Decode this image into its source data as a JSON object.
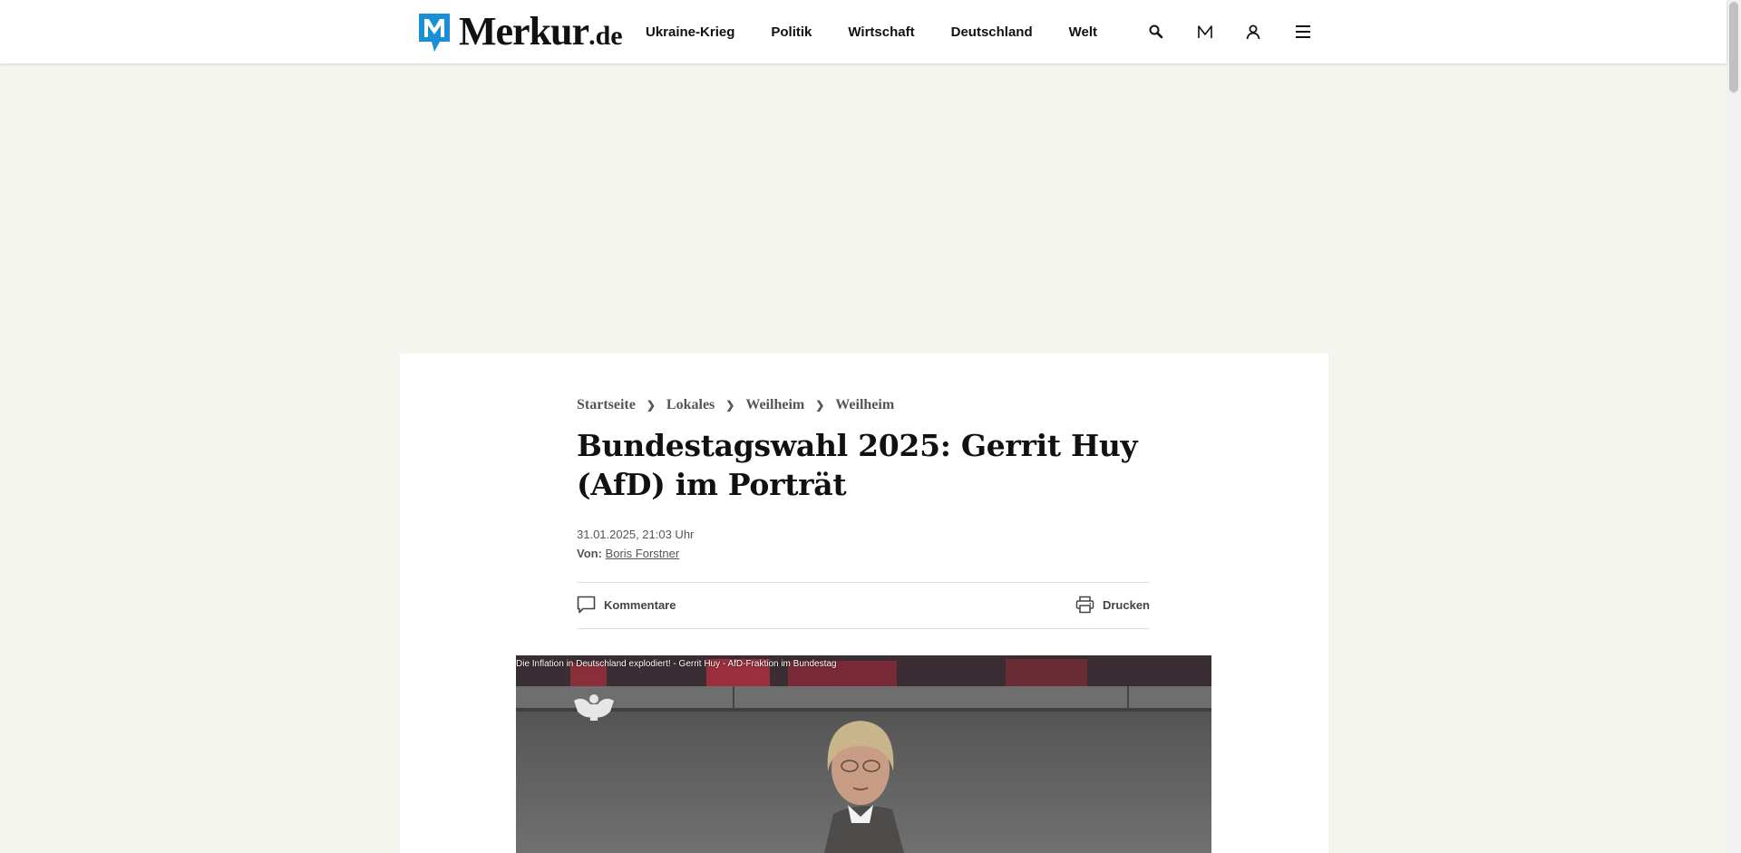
{
  "site": {
    "logo_text": "Merkur",
    "logo_tld": ".de",
    "brand_color": "#1a8fd6"
  },
  "nav": {
    "items": [
      {
        "label": "Ukraine-Krieg"
      },
      {
        "label": "Politik"
      },
      {
        "label": "Wirtschaft"
      },
      {
        "label": "Deutschland"
      },
      {
        "label": "Welt"
      }
    ],
    "icons": [
      "search-icon",
      "merkur-plus-icon",
      "user-icon",
      "menu-icon"
    ]
  },
  "breadcrumb": [
    {
      "label": "Startseite"
    },
    {
      "label": "Lokales"
    },
    {
      "label": "Weilheim"
    },
    {
      "label": "Weilheim"
    }
  ],
  "breadcrumb_separator": "❯",
  "article": {
    "headline": "Bundestagswahl 2025: Gerrit Huy (AfD) im Porträt",
    "date": "31.01.2025, 21:03 Uhr",
    "author_label": "Von:",
    "author_name": "Boris Forstner"
  },
  "toolbar": {
    "comments_label": "Kommentare",
    "print_label": "Drucken"
  },
  "video": {
    "caption": "Die Inflation in Deutschland explodiert! - Gerrit Huy - AfD-Fraktion im Bundestag"
  }
}
